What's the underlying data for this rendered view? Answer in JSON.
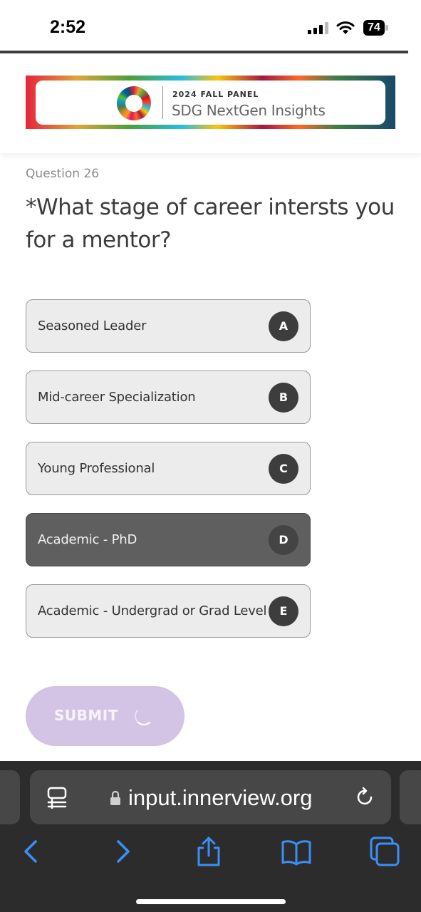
{
  "status_bar": {
    "time": "2:52",
    "battery": "74",
    "icons": [
      "signal-icon",
      "wifi-icon",
      "battery-icon"
    ]
  },
  "header": {
    "banner_small": "2024 FALL PANEL",
    "banner_title": "SDG NextGen Insights"
  },
  "question": {
    "number_label": "Question 26",
    "text": "*What stage of career intersts you for a mentor?"
  },
  "options": [
    {
      "label": "Seasoned Leader",
      "key": "A",
      "selected": false
    },
    {
      "label": "Mid-career Specialization",
      "key": "B",
      "selected": false
    },
    {
      "label": "Young Professional",
      "key": "C",
      "selected": false
    },
    {
      "label": "Academic - PhD",
      "key": "D",
      "selected": true
    },
    {
      "label": "Academic - Undergrad or Grad Level",
      "key": "E",
      "selected": false
    }
  ],
  "submit": {
    "label": "SUBMIT",
    "loading": true,
    "color": "#d3c4e6"
  },
  "browser": {
    "url": "input.innerview.org",
    "icons": [
      "reader-icon",
      "lock-icon",
      "reload-icon",
      "back-icon",
      "forward-icon",
      "share-icon",
      "bookmarks-icon",
      "tabs-icon"
    ],
    "accent": "#3a8ff7"
  }
}
